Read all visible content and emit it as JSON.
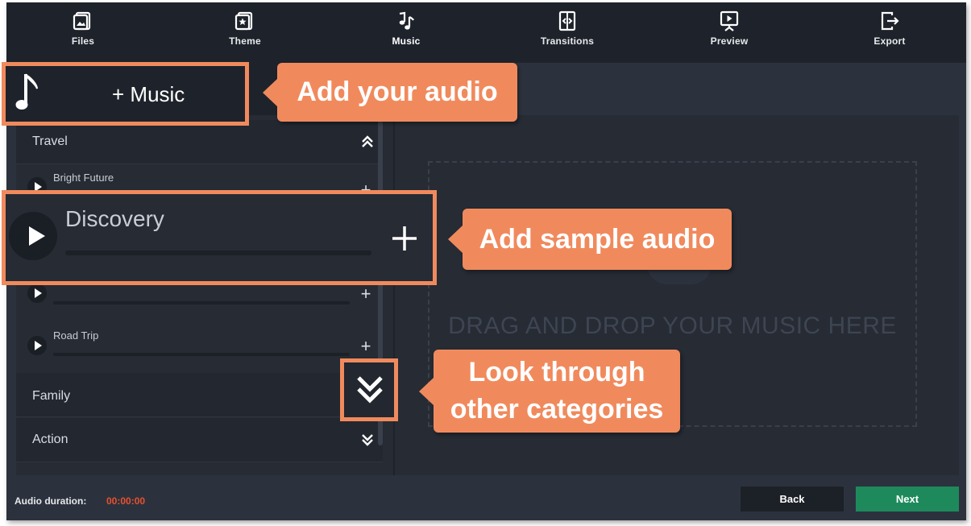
{
  "nav": {
    "items": [
      {
        "label": "Files",
        "icon": "files-icon"
      },
      {
        "label": "Theme",
        "icon": "theme-icon"
      },
      {
        "label": "Music",
        "icon": "music-icon"
      },
      {
        "label": "Transitions",
        "icon": "transitions-icon"
      },
      {
        "label": "Preview",
        "icon": "preview-icon"
      },
      {
        "label": "Export",
        "icon": "export-icon"
      }
    ],
    "active": "Music"
  },
  "add_music": {
    "label": "+ Music"
  },
  "categories": [
    {
      "label": "Travel",
      "state": "expanded"
    },
    {
      "label": "Family",
      "state": "collapsed"
    },
    {
      "label": "Action",
      "state": "collapsed"
    }
  ],
  "tracks": [
    {
      "title": "Bright Future"
    },
    {
      "title": "Discovery"
    },
    {
      "title": ""
    },
    {
      "title": "Road Trip"
    }
  ],
  "dropzone": {
    "text": "DRAG AND DROP YOUR MUSIC HERE"
  },
  "footer": {
    "duration_label": "Audio duration:",
    "duration_value": "00:00:00",
    "back_label": "Back",
    "next_label": "Next"
  },
  "annotations": {
    "add_audio": "Add your audio",
    "add_sample": "Add sample audio",
    "look_through_1": "Look through",
    "look_through_2": "other categories"
  },
  "colors": {
    "accent": "#f08a5d",
    "next_button": "#1e8a5c",
    "duration_value": "#e8502f",
    "nav_background": "#1e232b",
    "panel_background": "#262b34"
  }
}
